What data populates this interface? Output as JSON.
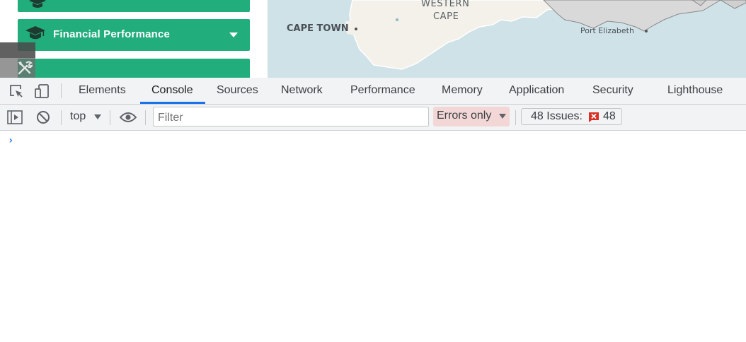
{
  "page": {
    "menu": {
      "financial_performance": "Financial Performance"
    },
    "map": {
      "region_line1": "WESTERN",
      "region_line2": "CAPE",
      "city_cape_town": "CAPE TOWN",
      "city_port_elizabeth": "Port Elizabeth"
    }
  },
  "devtools": {
    "tabs": [
      {
        "label": "Elements",
        "active": false
      },
      {
        "label": "Console",
        "active": true
      },
      {
        "label": "Sources",
        "active": false
      },
      {
        "label": "Network",
        "active": false
      },
      {
        "label": "Performance",
        "active": false
      },
      {
        "label": "Memory",
        "active": false
      },
      {
        "label": "Application",
        "active": false
      },
      {
        "label": "Security",
        "active": false
      },
      {
        "label": "Lighthouse",
        "active": false
      }
    ],
    "toolbar": {
      "context": "top",
      "filter_placeholder": "Filter",
      "filter_value": "",
      "levels": "Errors only",
      "issues_label": "48 Issues:",
      "issues_count": "48"
    },
    "console": {
      "prompt": "›"
    }
  },
  "colors": {
    "menu_green": "#22ad7c",
    "active_tab_accent": "#1a73e8",
    "error_red": "#d93025",
    "levels_highlight": "#f3d7d7"
  },
  "icons": [
    "graduation-cap-icon",
    "caret-down-icon",
    "tools-icon",
    "inspect-element-icon",
    "device-toolbar-icon",
    "sidebar-toggle-icon",
    "clear-console-icon",
    "eye-icon",
    "error-icon"
  ]
}
